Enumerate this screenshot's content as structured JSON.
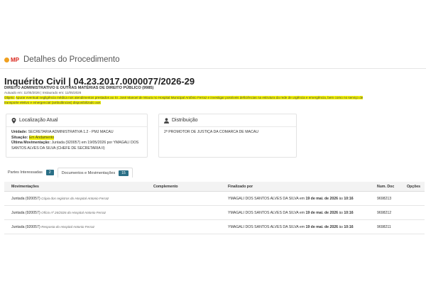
{
  "header": {
    "logo_text": "MP",
    "title": "Detalhes do Procedimento"
  },
  "procedure": {
    "title": "Inquérito Civil | 04.23.2017.0000077/2026-29",
    "subtitle": "DIREITO ADMINISTRATIVO E OUTRAS MATÉRIAS DE DIREITO PÚBLICO (9985)",
    "dates": "Autuado em: 11/05/2026 | Instaurado em: 11/05/2026",
    "objeto_label": "Objeto:",
    "objeto_text": "Apurar eventual negligência médica nos atendimentos prestados ao Sr. José Manoel de Moura no Hospital Municipal Antônio Ferraz e investigar possíveis deficiências na estrutura da rede de urgência e emergência, bem como no serviço de transporte eletivo e emergencial (ambulâncias) disponibilizado aos"
  },
  "localizacao": {
    "title": "Localização Atual",
    "unidade_label": "Unidade:",
    "unidade_value": "SECRETARIA ADMINISTRATIVA 1.2 - PMJ MACAU",
    "situacao_label": "Situação:",
    "situacao_value": "Em Andamento",
    "ultima_label": "Última Movimentação:",
    "ultima_value": "Juntada (920057) em 19/05/2026 por YMAGALI DOS SANTOS ALVES DA SILVA (CHEFE DE SECRETARIA II)"
  },
  "distribuicao": {
    "title": "Distribuição",
    "value": "2º PROMOTOR DE JUSTIÇA DA COMARCA DE MACAU"
  },
  "tabs": [
    {
      "label": "Partes Interessadas",
      "count": "2"
    },
    {
      "label": "Documentos e Movimentações",
      "count": "15"
    }
  ],
  "table": {
    "headers": [
      "Movimentações",
      "Complemento",
      "Finalizado por",
      "Num. Doc",
      "Opções"
    ],
    "rows": [
      {
        "mov": "Juntada (920057)",
        "desc": "Cópia dos registros do Hospital Antonio Ferraz",
        "complemento": "",
        "by": "YMAGALI DOS SANTOS ALVES DA SILVA",
        "em": " em ",
        "date": "19 de mai. de 2026",
        "as": " às ",
        "time": "10:16",
        "num": "9698213"
      },
      {
        "mov": "Juntada (920057)",
        "desc": "Ofício nº 26/2026 do Hospital Antonio Ferraz",
        "complemento": "",
        "by": "YMAGALI DOS SANTOS ALVES DA SILVA",
        "em": " em ",
        "date": "19 de mai. de 2026",
        "as": " às ",
        "time": "10:16",
        "num": "9698212"
      },
      {
        "mov": "Juntada (920057)",
        "desc": "Resposta do Hospital Antonio Ferraz",
        "complemento": "",
        "by": "YMAGALI DOS SANTOS ALVES DA SILVA",
        "em": " em ",
        "date": "19 de mai. de 2026",
        "as": " às ",
        "time": "10:16",
        "num": "9698211"
      }
    ]
  },
  "colors": {
    "accent": "#2a6f86",
    "highlight": "#f5f50a",
    "brand": "#d9261c"
  }
}
